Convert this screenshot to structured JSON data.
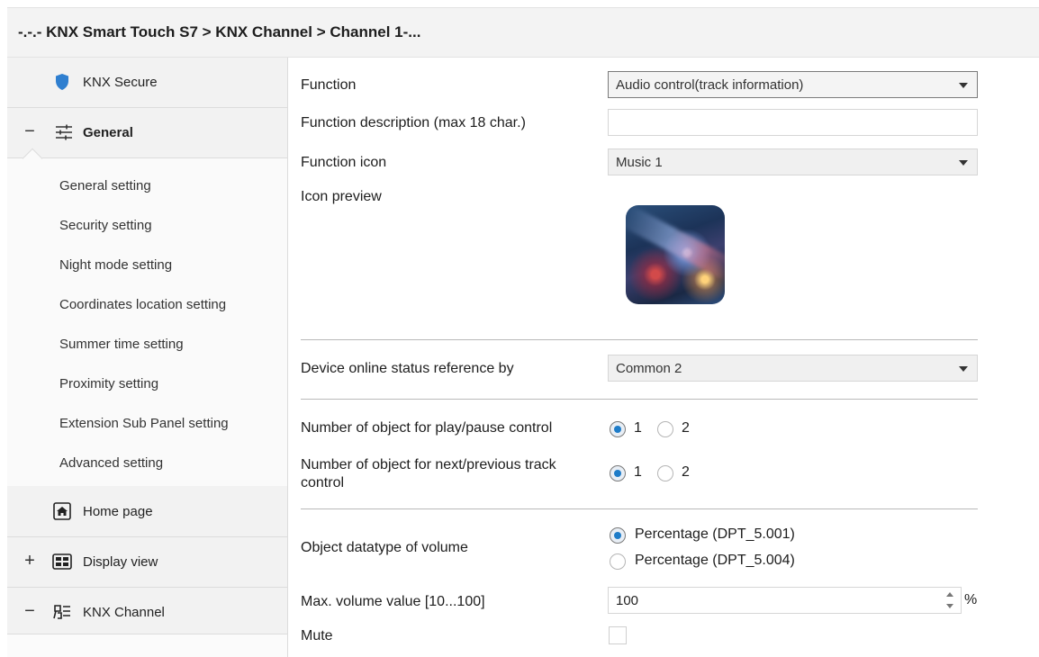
{
  "breadcrumb": "-.-.- KNX Smart Touch S7 > KNX Channel  > Channel 1-...",
  "sidebar": {
    "knx_secure": "KNX Secure",
    "general": {
      "toggle": "−",
      "label": "General"
    },
    "sub_items": [
      "General setting",
      "Security setting",
      "Night mode setting",
      "Coordinates location setting",
      "Summer time setting",
      "Proximity setting",
      "Extension Sub Panel setting",
      "Advanced setting"
    ],
    "home_page": "Home page",
    "display_view": {
      "toggle": "+",
      "label": "Display view"
    },
    "knx_channel": {
      "toggle": "−",
      "label": "KNX Channel"
    }
  },
  "form": {
    "function_label": "Function",
    "function_value": "Audio control(track information)",
    "description_label": "Function description (max 18 char.)",
    "description_value": "",
    "icon_label": "Function icon",
    "icon_value": "Music 1",
    "preview_label": "Icon preview",
    "online_status_label": "Device online status reference by",
    "online_status_value": "Common 2",
    "play_pause_label": "Number of object for play/pause control",
    "play_pause_options": [
      "1",
      "2"
    ],
    "play_pause_selected": "1",
    "next_prev_label_line1": "Number of object for next/previous track",
    "next_prev_label_line2": "control",
    "next_prev_options": [
      "1",
      "2"
    ],
    "next_prev_selected": "1",
    "datatype_label": "Object datatype of volume",
    "datatype_options": [
      "Percentage (DPT_5.001)",
      "Percentage (DPT_5.004)"
    ],
    "datatype_selected": "Percentage (DPT_5.001)",
    "max_volume_label": "Max. volume value [10...100]",
    "max_volume_value": "100",
    "max_volume_unit": "%",
    "mute_label": "Mute",
    "mute_checked": false
  },
  "colors": {
    "accent": "#1e7cc8",
    "shield": "#2f7fd0"
  }
}
